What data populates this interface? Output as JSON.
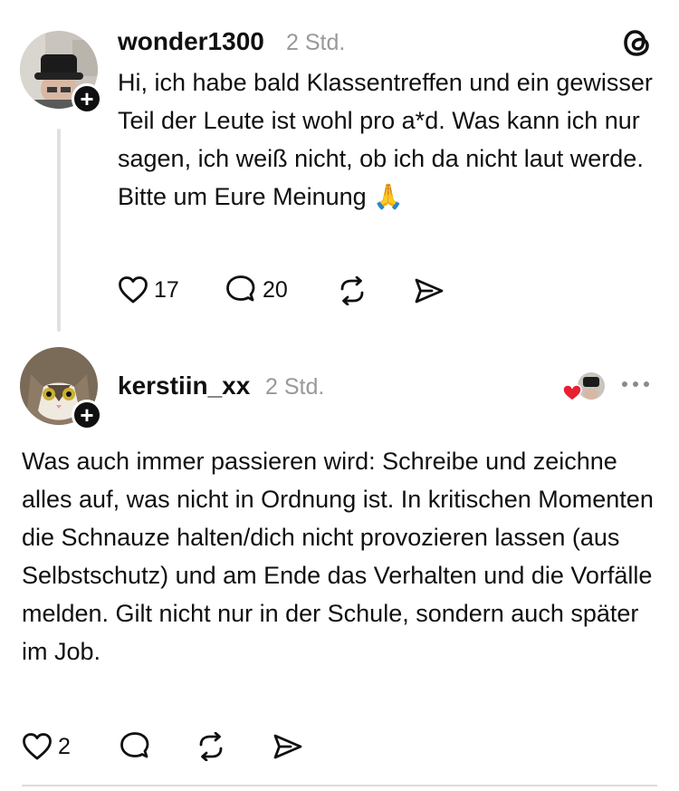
{
  "post1": {
    "username": "wonder1300",
    "time": "2 Std.",
    "text": "Hi, ich habe bald Klassentreffen und ein gewisser Teil der Leute ist wohl pro a*d. Was kann ich nur sagen, ich weiß nicht, ob ich da nicht laut werde. Bitte um Eure Meinung 🙏",
    "likes": "17",
    "replies": "20"
  },
  "post2": {
    "username": "kerstiin_xx",
    "time": "2 Std.",
    "text": "Was auch immer passieren wird: Schreibe und zeichne alles auf, was nicht in Ordnung ist. In kritischen Momenten die Schnauze halten/dich nicht provozieren lassen (aus Selbstschutz) und am Ende das Verhalten und die Vorfälle melden. Gilt nicht nur in der Schule, sondern auch später im Job.",
    "likes": "2"
  },
  "icons": {
    "app_logo": "threads-logo-icon",
    "like": "heart-icon",
    "reply": "speech-bubble-icon",
    "repost": "repost-arrows-icon",
    "share": "send-icon",
    "follow": "plus-icon",
    "more": "ellipsis-icon"
  },
  "colors": {
    "text": "#101010",
    "muted": "#999999",
    "thread_line": "#e0e0e0",
    "liked_heart": "#e8202f"
  }
}
